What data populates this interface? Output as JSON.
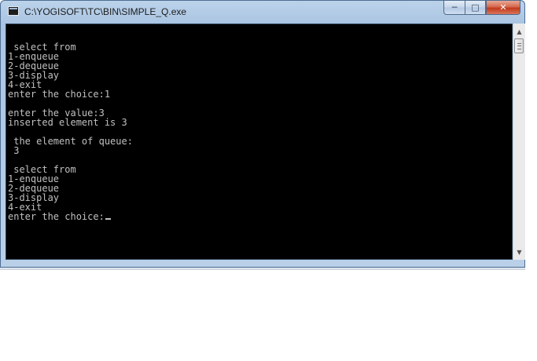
{
  "window": {
    "title": "C:\\YOGISOFT\\TC\\BIN\\SIMPLE_Q.exe",
    "controls": {
      "minimize": "─",
      "maximize": "□",
      "close": "✕"
    }
  },
  "console": {
    "lines": [
      "",
      " select from",
      "1-enqueue",
      "2-dequeue",
      "3-display",
      "4-exit",
      "enter the choice:1",
      "",
      "enter the value:3",
      "inserted element is 3",
      "",
      " the element of queue:",
      " 3",
      "",
      " select from",
      "1-enqueue",
      "2-dequeue",
      "3-display",
      "4-exit",
      "enter the choice:"
    ],
    "text_color": "#c0c0c0",
    "background": "#000000"
  },
  "scrollbar": {
    "up_arrow": "▲",
    "down_arrow": "▼"
  },
  "icons": {
    "app": "console-app-icon"
  }
}
